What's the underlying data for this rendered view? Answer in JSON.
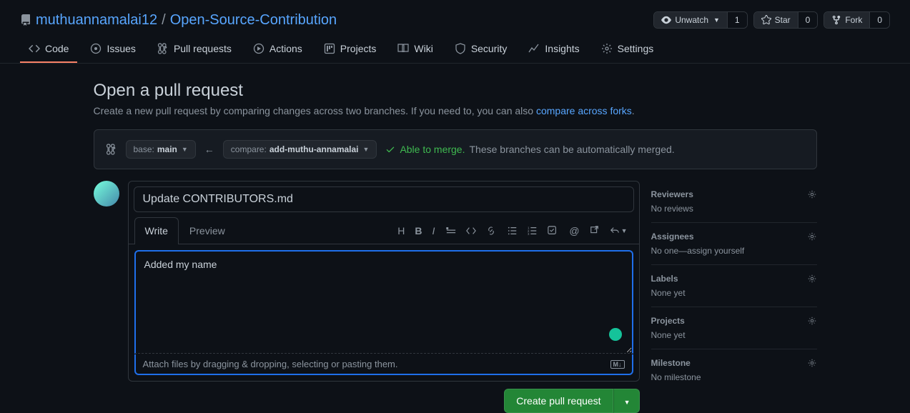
{
  "header": {
    "owner": "muthuannamalai12",
    "sep": "/",
    "repo": "Open-Source-Contribution",
    "watch": {
      "label": "Unwatch",
      "count": "1"
    },
    "star": {
      "label": "Star",
      "count": "0"
    },
    "fork": {
      "label": "Fork",
      "count": "0"
    }
  },
  "nav": {
    "code": "Code",
    "issues": "Issues",
    "pulls": "Pull requests",
    "actions": "Actions",
    "projects": "Projects",
    "wiki": "Wiki",
    "security": "Security",
    "insights": "Insights",
    "settings": "Settings"
  },
  "page": {
    "title": "Open a pull request",
    "subtitle_pre": "Create a new pull request by comparing changes across two branches. If you need to, you can also ",
    "subtitle_link": "compare across forks",
    "subtitle_post": "."
  },
  "compare": {
    "base_label": "base: ",
    "base_value": "main",
    "compare_label": "compare: ",
    "compare_value": "add-muthu-annamalai",
    "able": "Able to merge.",
    "desc": "These branches can be automatically merged."
  },
  "form": {
    "title_value": "Update CONTRIBUTORS.md",
    "tab_write": "Write",
    "tab_preview": "Preview",
    "body_value": "Added my name",
    "attach_text": "Attach files by dragging & dropping, selecting or pasting them.",
    "md": "M↓",
    "submit": "Create pull request"
  },
  "sidebar": {
    "reviewers": {
      "title": "Reviewers",
      "body": "No reviews"
    },
    "assignees": {
      "title": "Assignees",
      "body_pre": "No one—",
      "body_link": "assign yourself"
    },
    "labels": {
      "title": "Labels",
      "body": "None yet"
    },
    "projects": {
      "title": "Projects",
      "body": "None yet"
    },
    "milestone": {
      "title": "Milestone",
      "body": "No milestone"
    }
  }
}
